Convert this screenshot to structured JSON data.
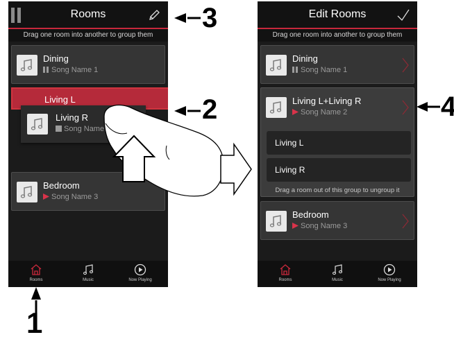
{
  "left_screen": {
    "title": "Rooms",
    "hint": "Drag one room into another to group them",
    "rooms": [
      {
        "name": "Dining",
        "song": "Song Name 1",
        "status": "paused"
      },
      {
        "name": "Living L",
        "song": "",
        "status": "dragging-target"
      },
      {
        "name": "Living R",
        "song": "Song Name",
        "status": "stopped"
      },
      {
        "name": "Bedroom",
        "song": "Song Name 3",
        "status": "playing"
      }
    ],
    "tabs": [
      {
        "label": "Rooms",
        "icon": "house-icon",
        "active": true
      },
      {
        "label": "Music",
        "icon": "music-note-icon",
        "active": false
      },
      {
        "label": "Now Playing",
        "icon": "play-circle-icon",
        "active": false
      }
    ]
  },
  "right_screen": {
    "title": "Edit Rooms",
    "hint": "Drag one room into another to group them",
    "rooms": [
      {
        "name": "Dining",
        "song": "Song Name 1",
        "status": "paused"
      },
      {
        "name": "Living L+Living R",
        "song": "Song Name 2",
        "status": "playing"
      },
      {
        "name": "Bedroom",
        "song": "Song Name 3",
        "status": "playing"
      }
    ],
    "group_members": [
      "Living L",
      "Living R"
    ],
    "group_hint": "Drag a room out of this group to ungroup it",
    "tabs": [
      {
        "label": "Rooms",
        "icon": "house-icon",
        "active": true
      },
      {
        "label": "Music",
        "icon": "music-note-icon",
        "active": false
      },
      {
        "label": "Now Playing",
        "icon": "play-circle-icon",
        "active": false
      }
    ]
  },
  "callouts": {
    "c1": "1",
    "c2": "2",
    "c3": "3",
    "c4": "4"
  },
  "colors": {
    "accent": "#c8283c",
    "playing": "#d9334a",
    "background": "#1b1b1b",
    "card": "#353535"
  }
}
